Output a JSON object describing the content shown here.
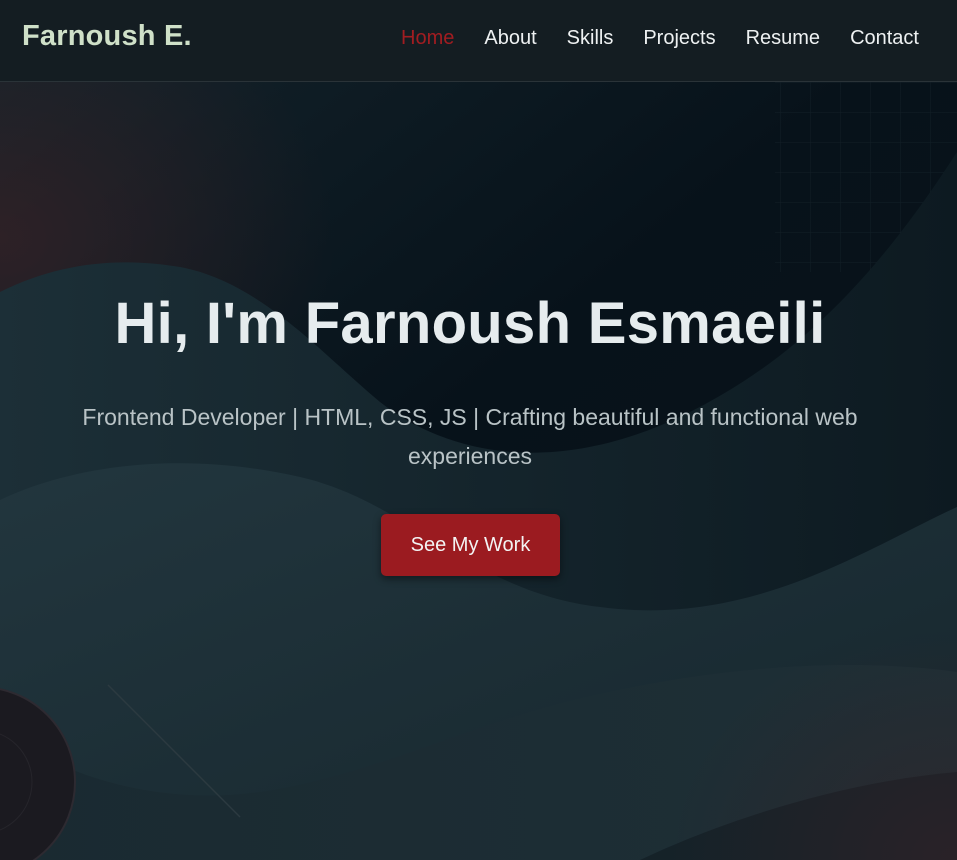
{
  "navbar": {
    "brand": "Farnoush E.",
    "links": [
      {
        "label": "Home",
        "active": true
      },
      {
        "label": "About",
        "active": false
      },
      {
        "label": "Skills",
        "active": false
      },
      {
        "label": "Projects",
        "active": false
      },
      {
        "label": "Resume",
        "active": false
      },
      {
        "label": "Contact",
        "active": false
      }
    ]
  },
  "hero": {
    "title": "Hi, I'm Farnoush Esmaeili",
    "subtitle": "Frontend Developer | HTML, CSS, JS | Crafting beautiful and functional web experiences",
    "cta_label": "See My Work"
  },
  "colors": {
    "accent": "#9b1b20",
    "active_link": "#a11d21",
    "brand": "#cfe0c8",
    "header_bg": "#141d22",
    "hero_bg": "#0b1419"
  }
}
